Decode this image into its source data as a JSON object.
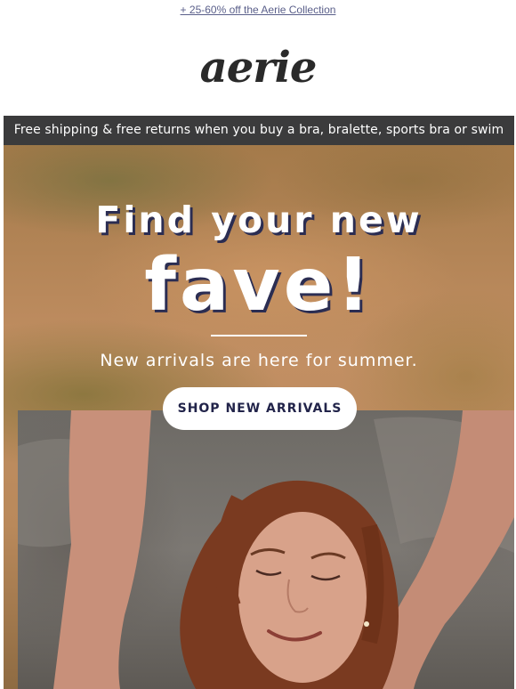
{
  "preheader": {
    "link_text": "+ 25-60% off the Aerie Collection"
  },
  "brand": {
    "logo_text": "aerie",
    "logo_color": "#2a2a2a"
  },
  "shipping_bar": {
    "text": "Free shipping & free returns when you buy a bra, bralette, sports bra or swim",
    "background": "#3b3b3c"
  },
  "hero": {
    "title_line1": "Find your new",
    "title_line2": "fave!",
    "subtitle": "New arrivals are here for summer.",
    "cta_label": "SHOP NEW ARRIVALS",
    "title_shadow_color": "#2b2d52",
    "cta_text_color": "#22244a"
  }
}
